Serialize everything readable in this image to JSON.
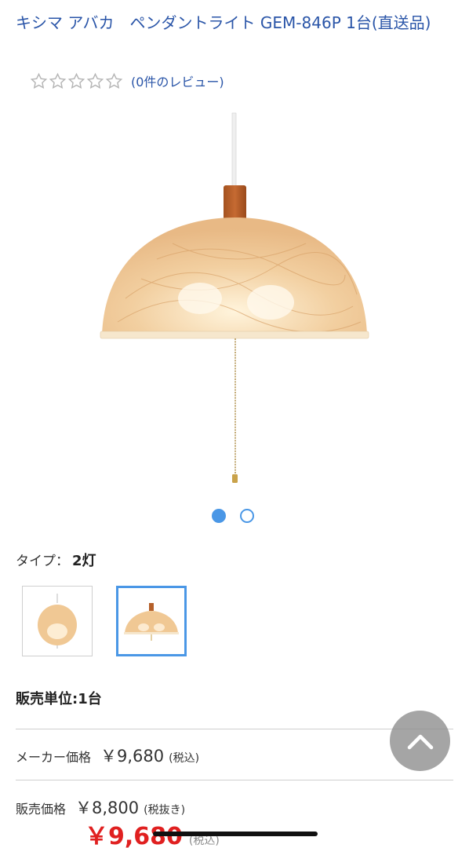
{
  "product": {
    "title": "キシマ アバカ　ペンダントライト GEM-846P 1台(直送品)",
    "review_link": "(0件のレビュー)",
    "rating": 0,
    "rating_max": 5
  },
  "gallery": {
    "main_image": "pendant-lamp-rattan-shade",
    "page_count": 2,
    "active_page": 1
  },
  "variant": {
    "label": "タイプ：",
    "value": "2灯",
    "options": [
      {
        "image": "round-rattan-pendant"
      },
      {
        "image": "dome-rattan-pendant",
        "selected": true
      }
    ]
  },
  "unit": {
    "text": "販売単位:1台"
  },
  "pricing": {
    "maker_label": "メーカー価格",
    "maker_price": "￥9,680",
    "maker_tax": "(税込)",
    "sale_label": "販売価格",
    "sale_price_ex": "￥8,800",
    "sale_tax_ex": "(税抜き)",
    "sale_price_in": "￥9,680",
    "sale_tax_in": "(税込)"
  },
  "icons": {
    "scroll_top": "chevron-up-icon",
    "star": "star-outline-icon"
  },
  "colors": {
    "link": "#2a55a8",
    "accent": "#4a97e6",
    "sale_red": "#e02020"
  }
}
